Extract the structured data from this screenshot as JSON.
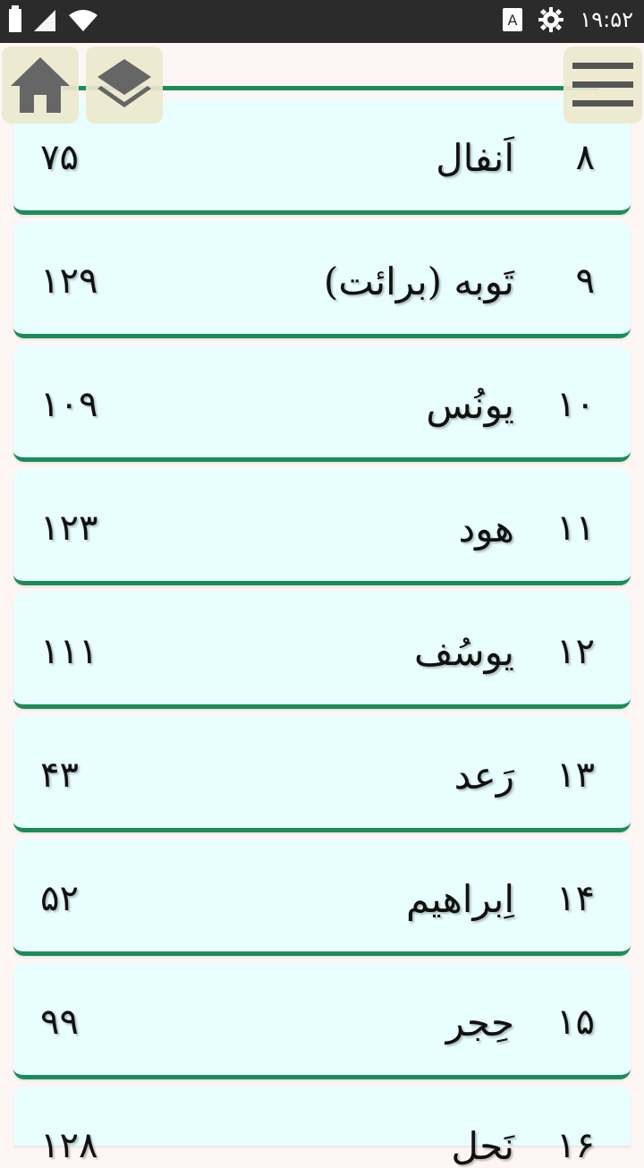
{
  "status_bar": {
    "time": "۱۹:۵۲",
    "icons": [
      "battery-icon",
      "signal-icon",
      "wifi-icon",
      "keyboard-a-icon",
      "gear-icon"
    ]
  },
  "toolbar": {
    "home_icon": "home-icon",
    "layers_icon": "layers-icon",
    "menu_icon": "hamburger-menu-icon"
  },
  "surahs": [
    {
      "num": "۸",
      "name": "اَنفال",
      "count": "۷۵"
    },
    {
      "num": "۹",
      "name": "تَوبه (برائت)",
      "count": "۱۲۹"
    },
    {
      "num": "۱۰",
      "name": "یونُس",
      "count": "۱۰۹"
    },
    {
      "num": "۱۱",
      "name": "هود",
      "count": "۱۲۳"
    },
    {
      "num": "۱۲",
      "name": "یوسُف",
      "count": "۱۱۱"
    },
    {
      "num": "۱۳",
      "name": "رَعد",
      "count": "۴۳"
    },
    {
      "num": "۱۴",
      "name": "اِبراهیم",
      "count": "۵۲"
    },
    {
      "num": "۱۵",
      "name": "حِجر",
      "count": "۹۹"
    },
    {
      "num": "۱۶",
      "name": "نَحل",
      "count": "۱۲۸"
    }
  ],
  "colors": {
    "card_bg": "#e9ffff",
    "accent_green": "#1b8c59",
    "status_bar": "#2b2b2b",
    "button_bg": "#ece8cd"
  }
}
